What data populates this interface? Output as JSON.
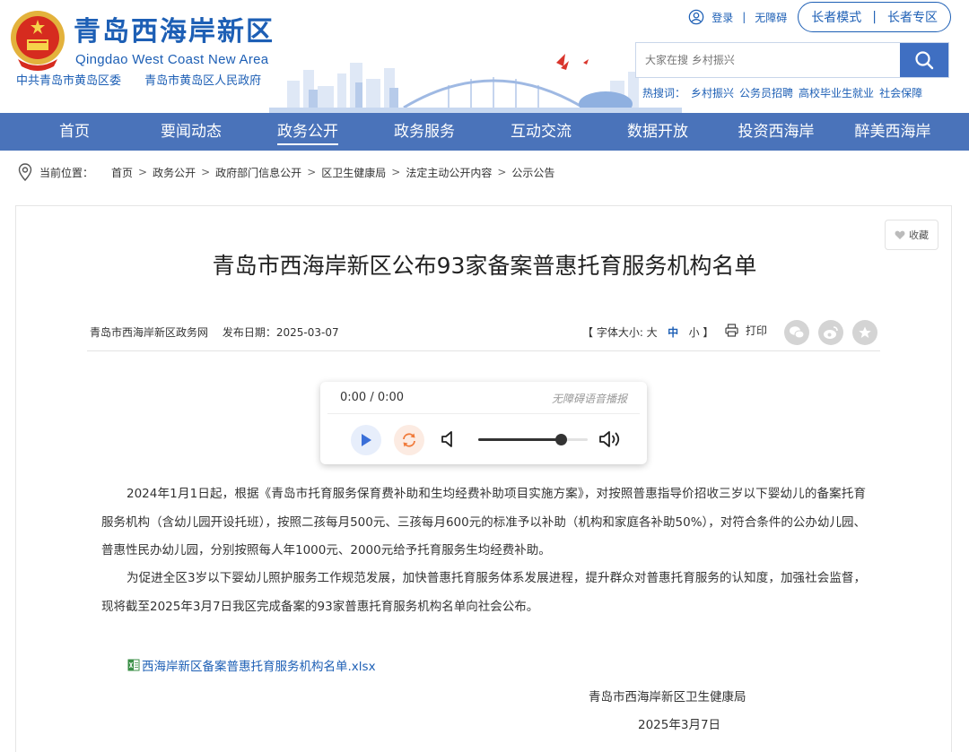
{
  "header": {
    "site_title": "青岛西海岸新区",
    "site_subtitle": "Qingdao West Coast New Area",
    "org_links": [
      "中共青岛市黄岛区委",
      "青岛市黄岛区人民政府"
    ],
    "login": "登录",
    "accessibility": "无障碍",
    "elder_mode": "长者模式",
    "elder_zone": "长者专区",
    "search_placeholder": "大家在搜 乡村振兴",
    "hot_label": "热搜词：",
    "hot_words": [
      "乡村振兴",
      "公务员招聘",
      "高校毕业生就业",
      "社会保障"
    ]
  },
  "nav": {
    "items": [
      "首页",
      "要闻动态",
      "政务公开",
      "政务服务",
      "互动交流",
      "数据开放",
      "投资西海岸",
      "醉美西海岸"
    ],
    "active_index": 2
  },
  "breadcrumb": {
    "label": "当前位置：",
    "items": [
      "首页",
      "政务公开",
      "政府部门信息公开",
      "区卫生健康局",
      "法定主动公开内容",
      "公示公告"
    ]
  },
  "article": {
    "favorite": "收藏",
    "title": "青岛市西海岸新区公布93家备案普惠托育服务机构名单",
    "source": "青岛市西海岸新区政务网",
    "date_label": "发布日期：2025-03-07",
    "fontsize_label": "【 字体大小: 大",
    "fontsize_mid": "中",
    "fontsize_small": "小 】",
    "print": "打印",
    "share_icons": [
      "wechat-icon",
      "weibo-icon",
      "favorite-star-icon"
    ],
    "paragraphs": [
      "2024年1月1日起，根据《青岛市托育服务保育费补助和生均经费补助项目实施方案》，对按照普惠指导价招收三岁以下婴幼儿的备案托育服务机构（含幼儿园开设托班），按照二孩每月500元、三孩每月600元的标准予以补助（机构和家庭各补助50%），对符合条件的公办幼儿园、普惠性民办幼儿园，分别按照每人年1000元、2000元给予托育服务生均经费补助。",
      "为促进全区3岁以下婴幼儿照护服务工作规范发展，加快普惠托育服务体系发展进程，提升群众对普惠托育服务的认知度，加强社会监督，现将截至2025年3月7日我区完成备案的93家普惠托育服务机构名单向社会公布。"
    ],
    "attachment": "西海岸新区备案普惠托育服务机构名单.xlsx",
    "signature": "青岛市西海岸新区卫生健康局",
    "signature_date": "2025年3月7日"
  },
  "player": {
    "time": "0:00 / 0:00",
    "label": "无障碍语音播报",
    "volume_fraction": 0.75
  },
  "colors": {
    "brand_blue": "#1d5fb5",
    "nav_bg": "#4a73ba",
    "search_btn": "#3f6fc2"
  }
}
